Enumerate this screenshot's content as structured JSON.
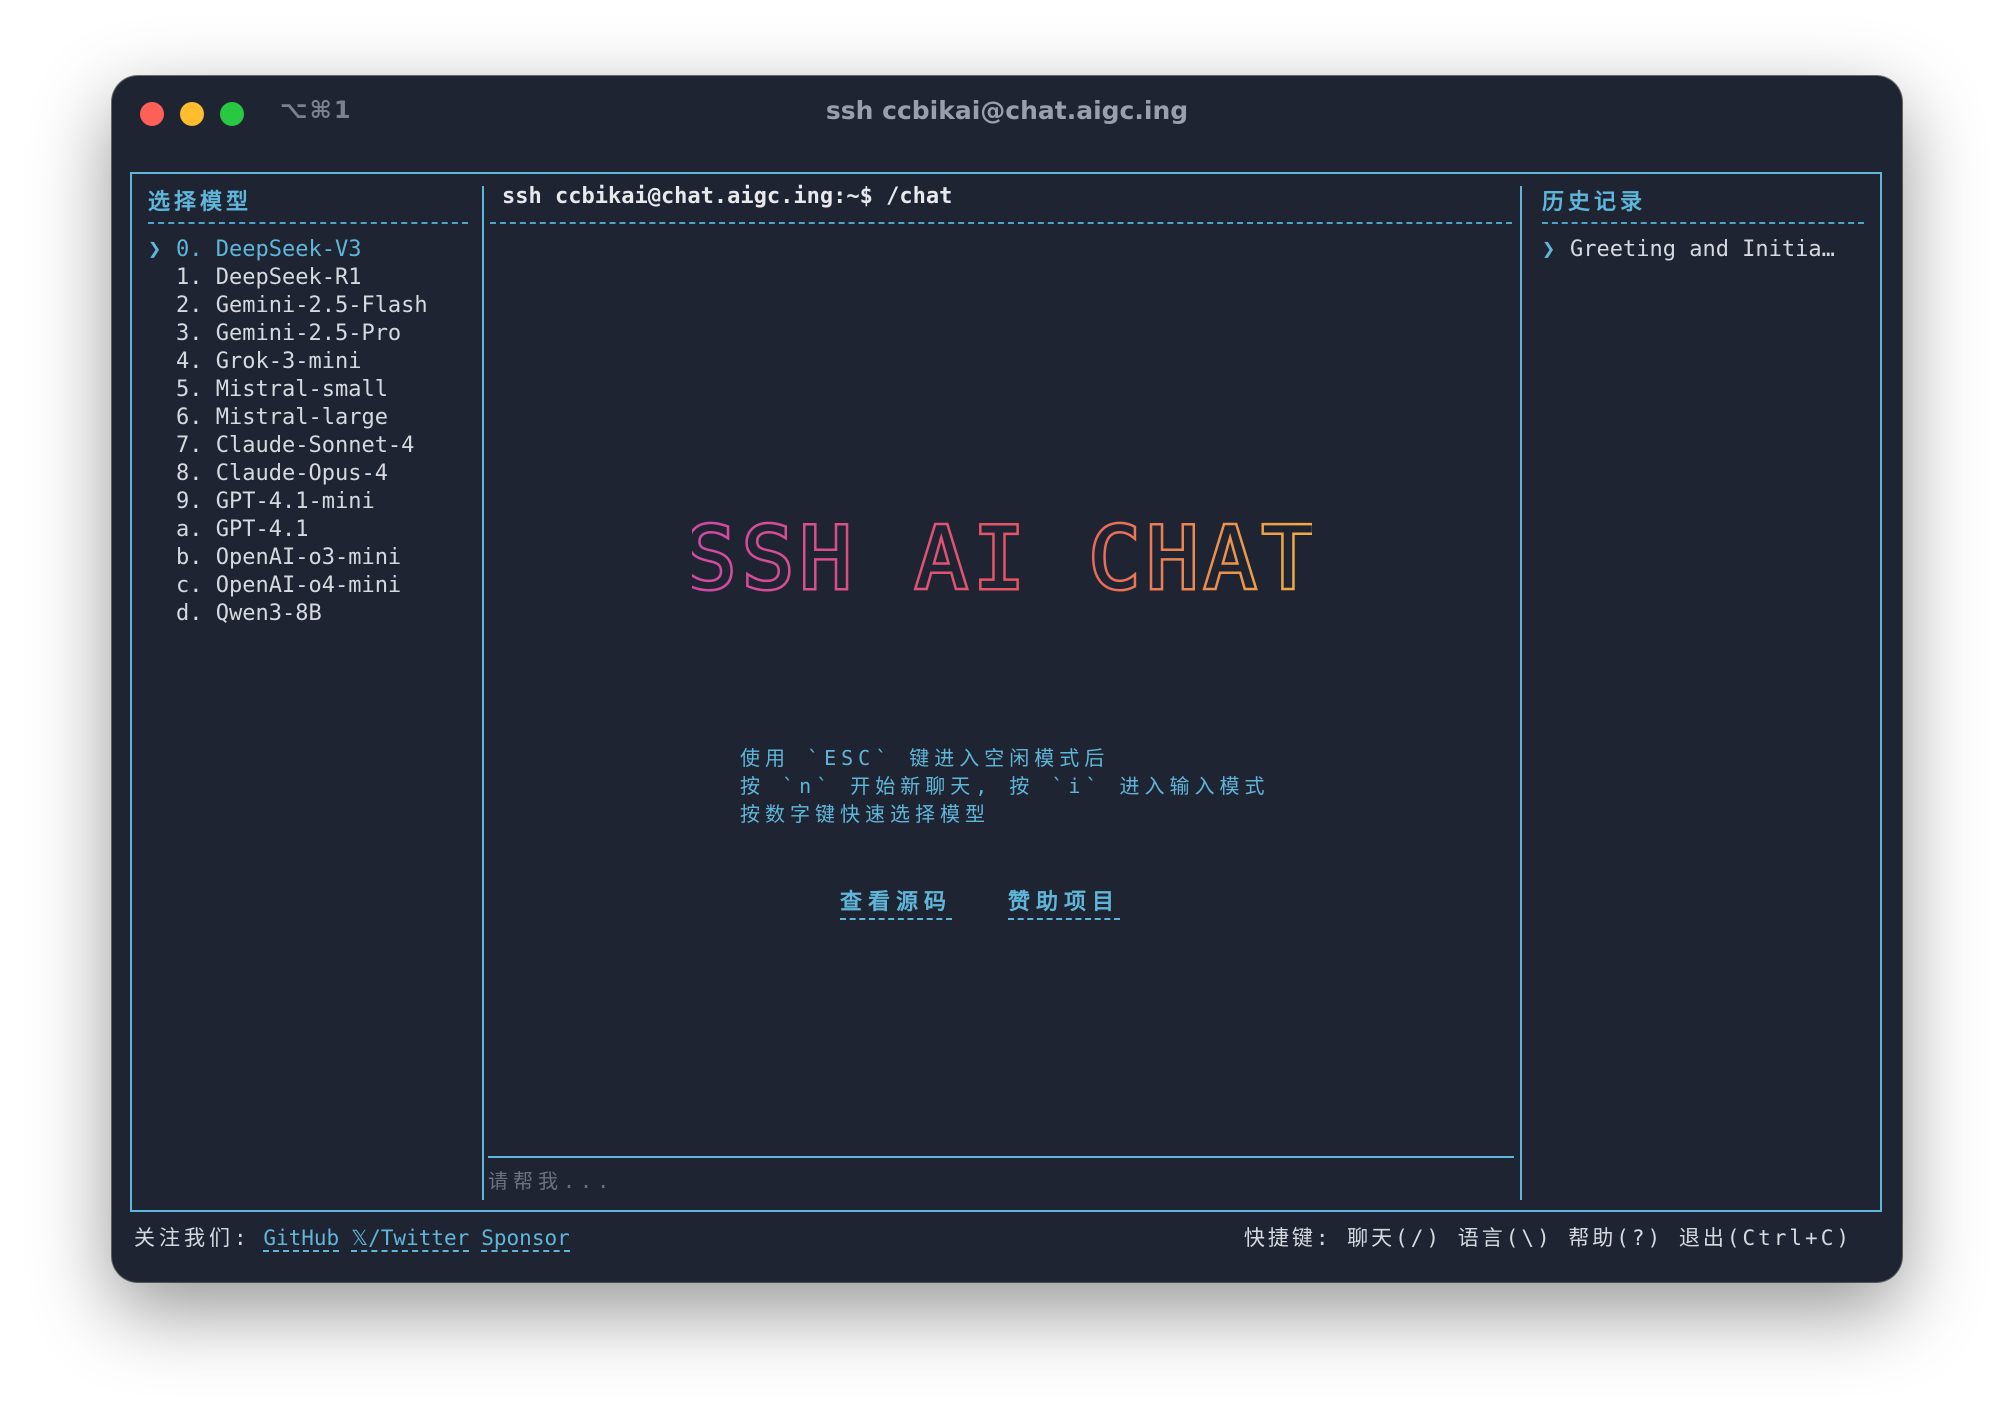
{
  "window": {
    "shortcut": "⌥⌘1",
    "title": "ssh ccbikai@chat.aigc.ing"
  },
  "sidebar": {
    "title": "选择模型",
    "marker": "❯",
    "items": [
      {
        "key": "0.",
        "label": "DeepSeek-V3"
      },
      {
        "key": "1.",
        "label": "DeepSeek-R1"
      },
      {
        "key": "2.",
        "label": "Gemini-2.5-Flash"
      },
      {
        "key": "3.",
        "label": "Gemini-2.5-Pro"
      },
      {
        "key": "4.",
        "label": "Grok-3-mini"
      },
      {
        "key": "5.",
        "label": "Mistral-small"
      },
      {
        "key": "6.",
        "label": "Mistral-large"
      },
      {
        "key": "7.",
        "label": "Claude-Sonnet-4"
      },
      {
        "key": "8.",
        "label": "Claude-Opus-4"
      },
      {
        "key": "9.",
        "label": "GPT-4.1-mini"
      },
      {
        "key": "a.",
        "label": "GPT-4.1"
      },
      {
        "key": "b.",
        "label": "OpenAI-o3-mini"
      },
      {
        "key": "c.",
        "label": "OpenAI-o4-mini"
      },
      {
        "key": "d.",
        "label": "Qwen3-8B"
      }
    ]
  },
  "main": {
    "command": "ssh ccbikai@chat.aigc.ing:~$ /chat",
    "banner": "SSH AI CHAT",
    "hints": [
      "使用 `ESC` 键进入空闲模式后",
      "按 `n` 开始新聊天, 按 `i` 进入输入模式",
      "按数字键快速选择模型"
    ],
    "links": {
      "source": "查看源码",
      "sponsor": "赞助项目"
    },
    "input_placeholder": "请帮我..."
  },
  "history": {
    "title": "历史记录",
    "marker": "❯",
    "items": [
      {
        "label": "Greeting and Initia…"
      }
    ]
  },
  "footer": {
    "follow_label": "关注我们:",
    "links": [
      "GitHub",
      "𝕏/Twitter",
      "Sponsor"
    ],
    "shortcuts": "快捷键: 聊天(/) 语言(\\) 帮助(?) 退出(Ctrl+C)"
  },
  "colors": {
    "background": "#1f2433",
    "accent": "#5fb6d9",
    "banner_gradient": [
      "#d04aa8",
      "#e9555f",
      "#f0b040"
    ]
  }
}
